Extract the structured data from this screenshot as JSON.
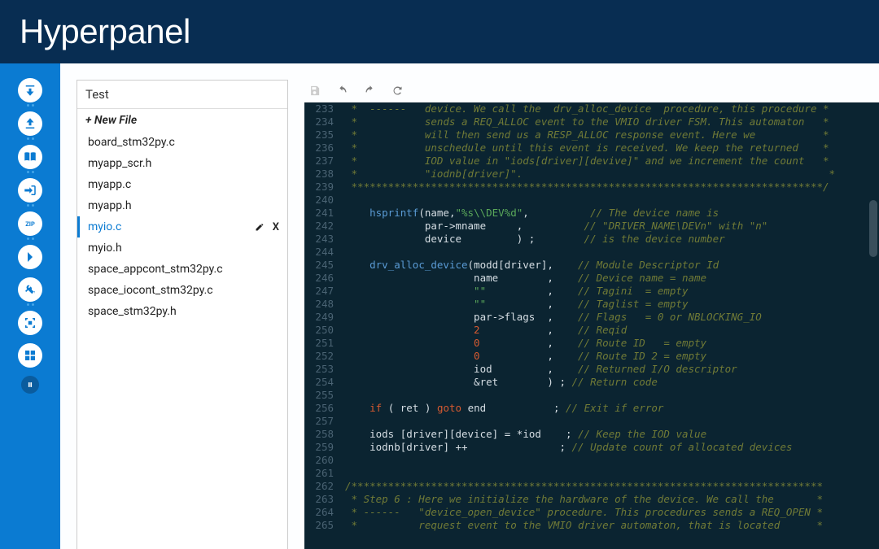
{
  "header": {
    "title": "Hyperpanel"
  },
  "sidebar": {
    "icons": [
      "download-icon",
      "upload-icon",
      "book-icon",
      "login-icon",
      "zip-icon",
      "expand-icon",
      "tools-icon",
      "target-icon",
      "grid-icon",
      "pause-icon"
    ]
  },
  "fileTree": {
    "title": "Test",
    "newFile": "+ New File",
    "files": [
      {
        "name": "board_stm32py.c",
        "active": false
      },
      {
        "name": "myapp_scr.h",
        "active": false
      },
      {
        "name": "myapp.c",
        "active": false
      },
      {
        "name": "myapp.h",
        "active": false
      },
      {
        "name": "myio.c",
        "active": true
      },
      {
        "name": "myio.h",
        "active": false
      },
      {
        "name": "space_appcont_stm32py.c",
        "active": false
      },
      {
        "name": "space_iocont_stm32py.c",
        "active": false
      },
      {
        "name": "space_stm32py.h",
        "active": false
      }
    ]
  },
  "toolbar": {
    "buttons": [
      "save",
      "undo",
      "redo",
      "reload"
    ]
  },
  "code": {
    "firstLine": 233,
    "lines": [
      {
        "n": 233,
        "html": "<span class='c-comment'> *  ------   device. We call the  drv_alloc_device  procedure, this procedure *</span>"
      },
      {
        "n": 234,
        "html": "<span class='c-comment'> *           sends a REQ_ALLOC event to the VMIO driver FSM. This automaton   *</span>"
      },
      {
        "n": 235,
        "html": "<span class='c-comment'> *           will then send us a RESP_ALLOC response event. Here we           *</span>"
      },
      {
        "n": 236,
        "html": "<span class='c-comment'> *           unschedule until this event is received. We keep the returned    *</span>"
      },
      {
        "n": 237,
        "html": "<span class='c-comment'> *           IOD value in \"iods[driver][devive]\" and we increment the count   *</span>"
      },
      {
        "n": 238,
        "html": "<span class='c-comment'> *           \"iodnb[driver]\".                                                  *</span>"
      },
      {
        "n": 239,
        "html": "<span class='c-stars'> *****************************************************************************/</span>"
      },
      {
        "n": 240,
        "html": ""
      },
      {
        "n": 241,
        "html": "    <span class='c-func'>hsprintf</span><span class='c-paren'>(</span><span class='c-ident'>name</span><span class='c-punct'>,</span><span class='c-string'>\"%s\\\\DEV%d\"</span><span class='c-punct'>,</span>          <span class='c-comment'>// The device name is</span>"
      },
      {
        "n": 242,
        "html": "             <span class='c-ident'>par-&gt;mname</span>     <span class='c-punct'>,</span>          <span class='c-comment'>// \"DRIVER_NAME\\DEVn\" with \"n\"</span>"
      },
      {
        "n": 243,
        "html": "             <span class='c-ident'>device</span>         <span class='c-paren'>)</span> <span class='c-punct'>;</span>        <span class='c-comment'>// is the device number</span>"
      },
      {
        "n": 244,
        "html": ""
      },
      {
        "n": 245,
        "html": "    <span class='c-func'>drv_alloc_device</span><span class='c-paren'>(</span><span class='c-ident'>modd</span><span class='c-paren'>[</span><span class='c-ident'>driver</span><span class='c-paren'>]</span><span class='c-punct'>,</span>    <span class='c-comment'>// Module Descriptor Id</span>"
      },
      {
        "n": 246,
        "html": "                     <span class='c-ident'>name</span>        <span class='c-punct'>,</span>    <span class='c-comment'>// Device name = name</span>"
      },
      {
        "n": 247,
        "html": "                     <span class='c-string'>\"\"</span>          <span class='c-punct'>,</span>    <span class='c-comment'>// Tagini  = empty</span>"
      },
      {
        "n": 248,
        "html": "                     <span class='c-string'>\"\"</span>          <span class='c-punct'>,</span>    <span class='c-comment'>// Taglist = empty</span>"
      },
      {
        "n": 249,
        "html": "                     <span class='c-ident'>par-&gt;flags</span>  <span class='c-punct'>,</span>    <span class='c-comment'>// Flags   = 0 or NBLOCKING_IO</span>"
      },
      {
        "n": 250,
        "html": "                     <span class='c-number'>2</span>           <span class='c-punct'>,</span>    <span class='c-comment'>// Reqid</span>"
      },
      {
        "n": 251,
        "html": "                     <span class='c-number'>0</span>           <span class='c-punct'>,</span>    <span class='c-comment'>// Route ID   = empty</span>"
      },
      {
        "n": 252,
        "html": "                     <span class='c-number'>0</span>           <span class='c-punct'>,</span>    <span class='c-comment'>// Route ID 2 = empty</span>"
      },
      {
        "n": 253,
        "html": "                     <span class='c-ident'>iod</span>         <span class='c-punct'>,</span>    <span class='c-comment'>// Returned I/O descriptor</span>"
      },
      {
        "n": 254,
        "html": "                     <span class='c-ident'>&amp;ret</span>        <span class='c-paren'>)</span> <span class='c-punct'>;</span> <span class='c-comment'>// Return code</span>"
      },
      {
        "n": 255,
        "html": ""
      },
      {
        "n": 256,
        "html": "    <span class='c-keyword'>if</span> <span class='c-paren'>(</span> <span class='c-ident'>ret</span> <span class='c-paren'>)</span> <span class='c-keyword'>goto</span> <span class='c-ident'>end</span>           <span class='c-punct'>;</span> <span class='c-comment'>// Exit if error</span>"
      },
      {
        "n": 257,
        "html": ""
      },
      {
        "n": 258,
        "html": "    <span class='c-ident'>iods</span> <span class='c-paren'>[</span><span class='c-ident'>driver</span><span class='c-paren'>][</span><span class='c-ident'>device</span><span class='c-paren'>]</span> <span class='c-op'>=</span> <span class='c-op'>*</span><span class='c-ident'>iod</span>    <span class='c-punct'>;</span> <span class='c-comment'>// Keep the IOD value</span>"
      },
      {
        "n": 259,
        "html": "    <span class='c-ident'>iodnb</span><span class='c-paren'>[</span><span class='c-ident'>driver</span><span class='c-paren'>]</span> <span class='c-op'>++</span>               <span class='c-punct'>;</span> <span class='c-comment'>// Update count of allocated devices</span>"
      },
      {
        "n": 260,
        "html": ""
      },
      {
        "n": 261,
        "html": ""
      },
      {
        "n": 262,
        "html": "<span class='c-stars'>/*****************************************************************************</span>"
      },
      {
        "n": 263,
        "html": "<span class='c-comment'> * Step 6 : Here we initialize the hardware of the device. We call the       *</span>"
      },
      {
        "n": 264,
        "html": "<span class='c-comment'> * ------   \"device_open_device\" procedure. This procedures sends a REQ_OPEN *</span>"
      },
      {
        "n": 265,
        "html": "<span class='c-comment'> *          request event to the VMIO driver automaton, that is located      *</span>"
      }
    ]
  }
}
